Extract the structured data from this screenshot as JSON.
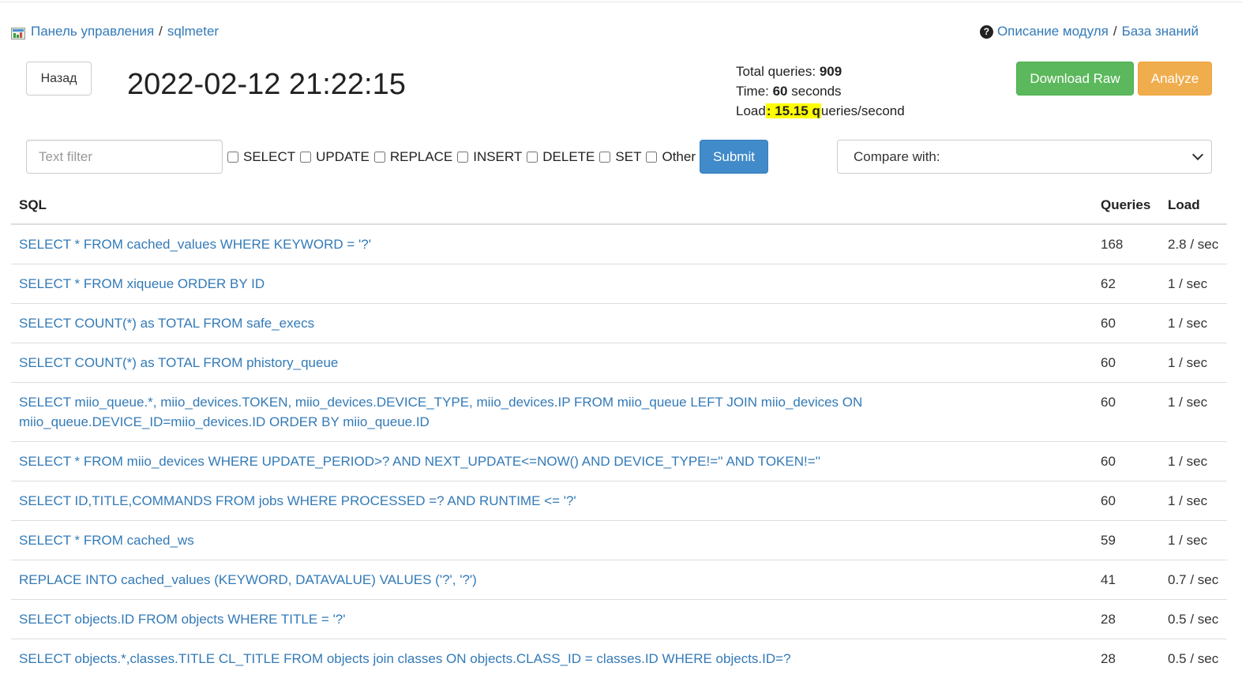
{
  "breadcrumb": {
    "home": "Панель управления",
    "separator": "/",
    "current": "sqlmeter"
  },
  "links": {
    "module_description": "Описание модуля",
    "separator": "/",
    "knowledge_base": "База знаний"
  },
  "header": {
    "back_label": "Назад",
    "title": "2022-02-12 21:22:15",
    "download_label": "Download Raw",
    "analyze_label": "Analyze"
  },
  "stats": {
    "total_label": "Total queries: ",
    "total_value": "909",
    "time_label": "Time: ",
    "time_value": "60",
    "time_unit": " seconds",
    "load_label": "Load",
    "load_value": ": 15.15 q",
    "load_unit": "ueries/second"
  },
  "filter": {
    "text_placeholder": "Text filter",
    "checkboxes": [
      "SELECT",
      "UPDATE",
      "REPLACE",
      "INSERT",
      "DELETE",
      "SET",
      "Other"
    ],
    "submit_label": "Submit",
    "compare_selected": "Compare with:"
  },
  "table": {
    "headers": [
      "SQL",
      "Queries",
      "Load"
    ],
    "rows": [
      {
        "sql": "SELECT * FROM cached_values WHERE KEYWORD = '?'",
        "queries": "168",
        "load": "2.8 / sec"
      },
      {
        "sql": "SELECT * FROM xiqueue ORDER BY ID",
        "queries": "62",
        "load": "1 / sec"
      },
      {
        "sql": "SELECT COUNT(*) as TOTAL FROM safe_execs",
        "queries": "60",
        "load": "1 / sec"
      },
      {
        "sql": "SELECT COUNT(*) as TOTAL FROM phistory_queue",
        "queries": "60",
        "load": "1 / sec"
      },
      {
        "sql": "SELECT miio_queue.*, miio_devices.TOKEN, miio_devices.DEVICE_TYPE, miio_devices.IP FROM miio_queue LEFT JOIN miio_devices ON miio_queue.DEVICE_ID=miio_devices.ID ORDER BY miio_queue.ID",
        "queries": "60",
        "load": "1 / sec"
      },
      {
        "sql": "SELECT * FROM miio_devices WHERE UPDATE_PERIOD>? AND NEXT_UPDATE<=NOW() AND DEVICE_TYPE!='' AND TOKEN!=''",
        "queries": "60",
        "load": "1 / sec"
      },
      {
        "sql": "SELECT ID,TITLE,COMMANDS FROM jobs WHERE PROCESSED =? AND RUNTIME <= '?'",
        "queries": "60",
        "load": "1 / sec"
      },
      {
        "sql": "SELECT * FROM cached_ws",
        "queries": "59",
        "load": "1 / sec"
      },
      {
        "sql": "REPLACE INTO cached_values (KEYWORD, DATAVALUE) VALUES ('?', '?')",
        "queries": "41",
        "load": "0.7 / sec"
      },
      {
        "sql": "SELECT objects.ID FROM objects WHERE TITLE = '?'",
        "queries": "28",
        "load": "0.5 / sec"
      },
      {
        "sql": "SELECT objects.*,classes.TITLE CL_TITLE FROM objects join classes ON objects.CLASS_ID = classes.ID WHERE objects.ID=?",
        "queries": "28",
        "load": "0.5 / sec"
      }
    ]
  },
  "colors": {
    "link": "#337ab7",
    "download": "#5cb85c",
    "analyze": "#f0ad4e",
    "submit": "#428bca",
    "highlight": "#ffff00"
  }
}
